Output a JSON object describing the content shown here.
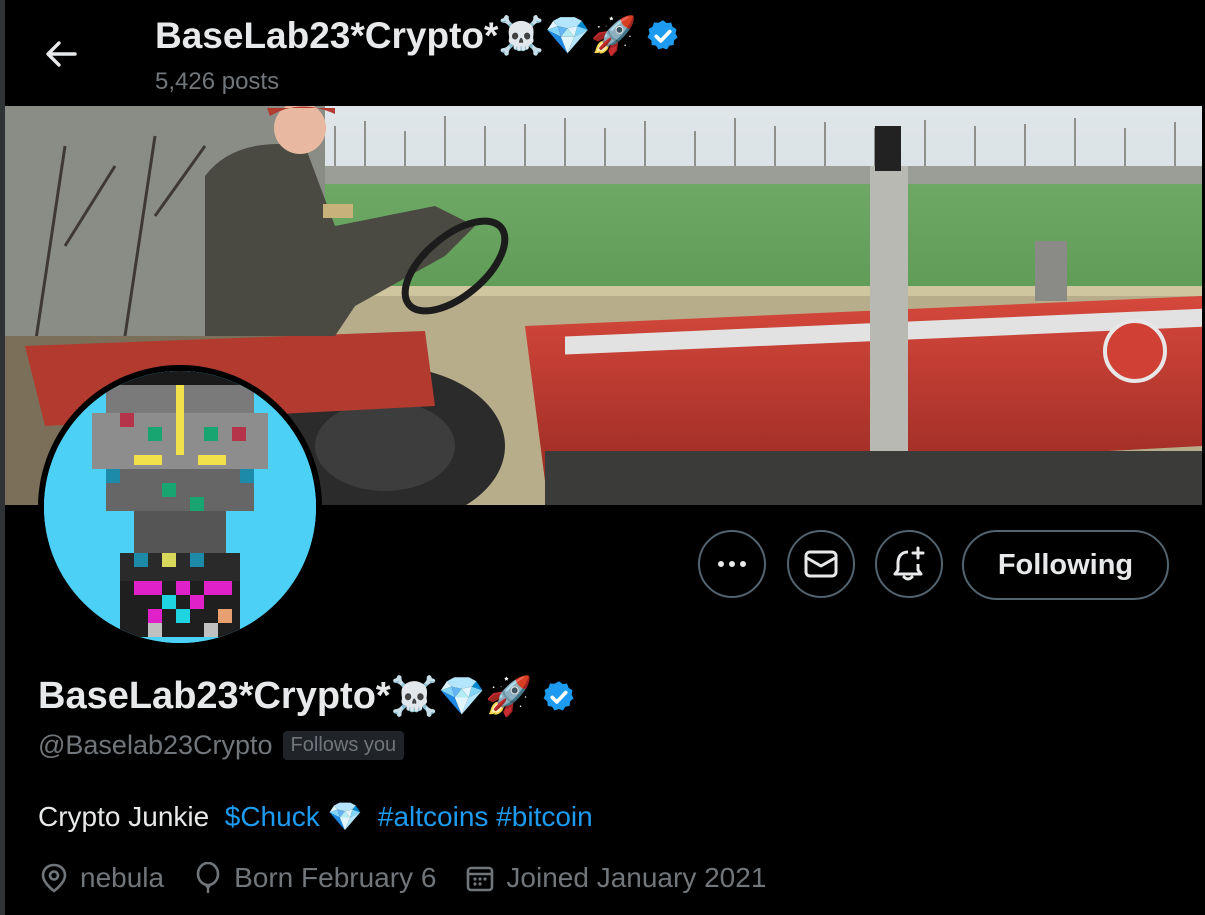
{
  "header": {
    "back_icon": "arrow-left-icon",
    "name": "BaseLab23*Crypto*",
    "name_emojis": "☠️💎🚀",
    "posts": "5,426 posts",
    "verified_icon": "verified-badge-icon",
    "verified_color": "#1d9bf0"
  },
  "banner": {
    "description": "tractor-photo"
  },
  "actions": {
    "more_icon": "more-icon",
    "message_icon": "mail-icon",
    "notify_icon": "bell-plus-icon",
    "following_label": "Following"
  },
  "profile": {
    "name": "BaseLab23*Crypto*",
    "name_emojis": "☠️💎🚀",
    "handle": "@Baselab23Crypto",
    "follows_you": "Follows you",
    "bio_text": "Crypto Junkie",
    "bio_cashtag": "$Chuck",
    "bio_emoji": "💎",
    "bio_hashtag1": "#altcoins",
    "bio_hashtag2": "#bitcoin",
    "location": "nebula",
    "birthday": "Born February 6",
    "joined": "Joined January 2021",
    "link_color": "#1d9bf0"
  }
}
